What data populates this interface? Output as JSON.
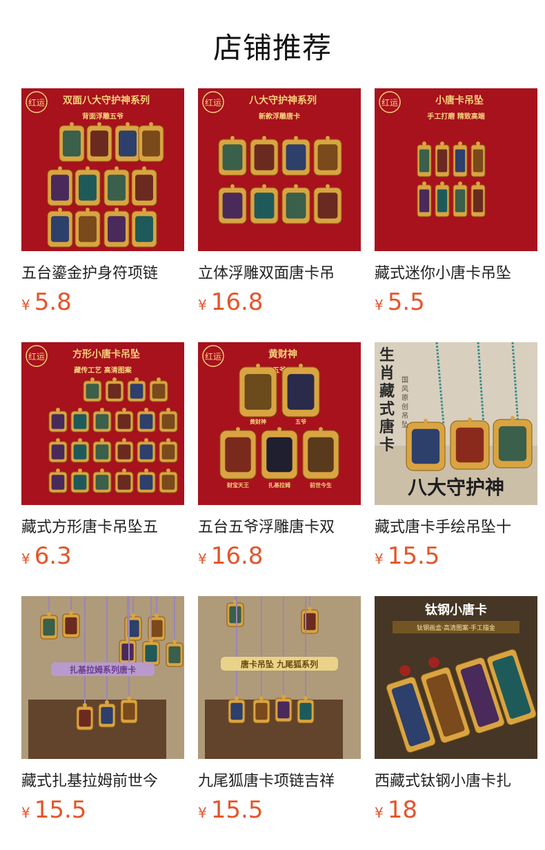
{
  "page": {
    "title": "店铺推荐"
  },
  "currency_symbol": "¥",
  "products": [
    {
      "name": "五台鎏金护身符项链",
      "price": "5.8",
      "image": {
        "overlay_text": [
          "双面八大守护神系列",
          "背面浮雕五爷"
        ],
        "logo_text": "红运",
        "scene": "red"
      }
    },
    {
      "name": "立体浮雕双面唐卡吊",
      "price": "16.8",
      "image": {
        "overlay_text": [
          "八大守护神系列",
          "新款浮雕唐卡"
        ],
        "logo_text": "红运",
        "scene": "red"
      }
    },
    {
      "name": "藏式迷你小唐卡吊坠",
      "price": "5.5",
      "image": {
        "overlay_text": [
          "小唐卡吊坠",
          "手工打磨 精致高端"
        ],
        "logo_text": "红运",
        "scene": "red"
      }
    },
    {
      "name": "藏式方形唐卡吊坠五",
      "price": "6.3",
      "image": {
        "overlay_text": [
          "方形小唐卡吊坠",
          "藏传工艺 高清图案"
        ],
        "logo_text": "红运",
        "scene": "red"
      }
    },
    {
      "name": "五台五爷浮雕唐卡双",
      "price": "16.8",
      "image": {
        "overlay_text": [
          "黄财神",
          "五爷",
          "财宝天王",
          "扎基拉姆",
          "前世今生"
        ],
        "logo_text": "红运",
        "scene": "red"
      }
    },
    {
      "name": "藏式唐卡手绘吊坠十",
      "price": "15.5",
      "image": {
        "overlay_text": [
          "生肖藏式唐卡",
          "国风原创吊坠",
          "八大守护神"
        ],
        "scene": "beige"
      }
    },
    {
      "name": "藏式扎基拉姆前世今",
      "price": "15.5",
      "image": {
        "overlay_text": [
          "扎基拉姆系列唐卡"
        ],
        "scene": "wood"
      }
    },
    {
      "name": "九尾狐唐卡项链吉祥",
      "price": "15.5",
      "image": {
        "overlay_text": [
          "唐卡吊坠 九尾狐系列"
        ],
        "scene": "wood"
      }
    },
    {
      "name": "西藏式钛钢小唐卡扎",
      "price": "18",
      "image": {
        "overlay_text": [
          "钛钢小唐卡",
          "钛钢画盒·高清图案·手工描金"
        ],
        "scene": "dark"
      }
    }
  ],
  "colors": {
    "price": "#e5542a",
    "red_bg": "#b0141f",
    "gold": "#d9a441",
    "gold_text": "#f5d27a",
    "beige_bg": "#d9cfbe",
    "wood_bg": "#7a5a3c",
    "dark_bg": "#3b2e1f"
  }
}
